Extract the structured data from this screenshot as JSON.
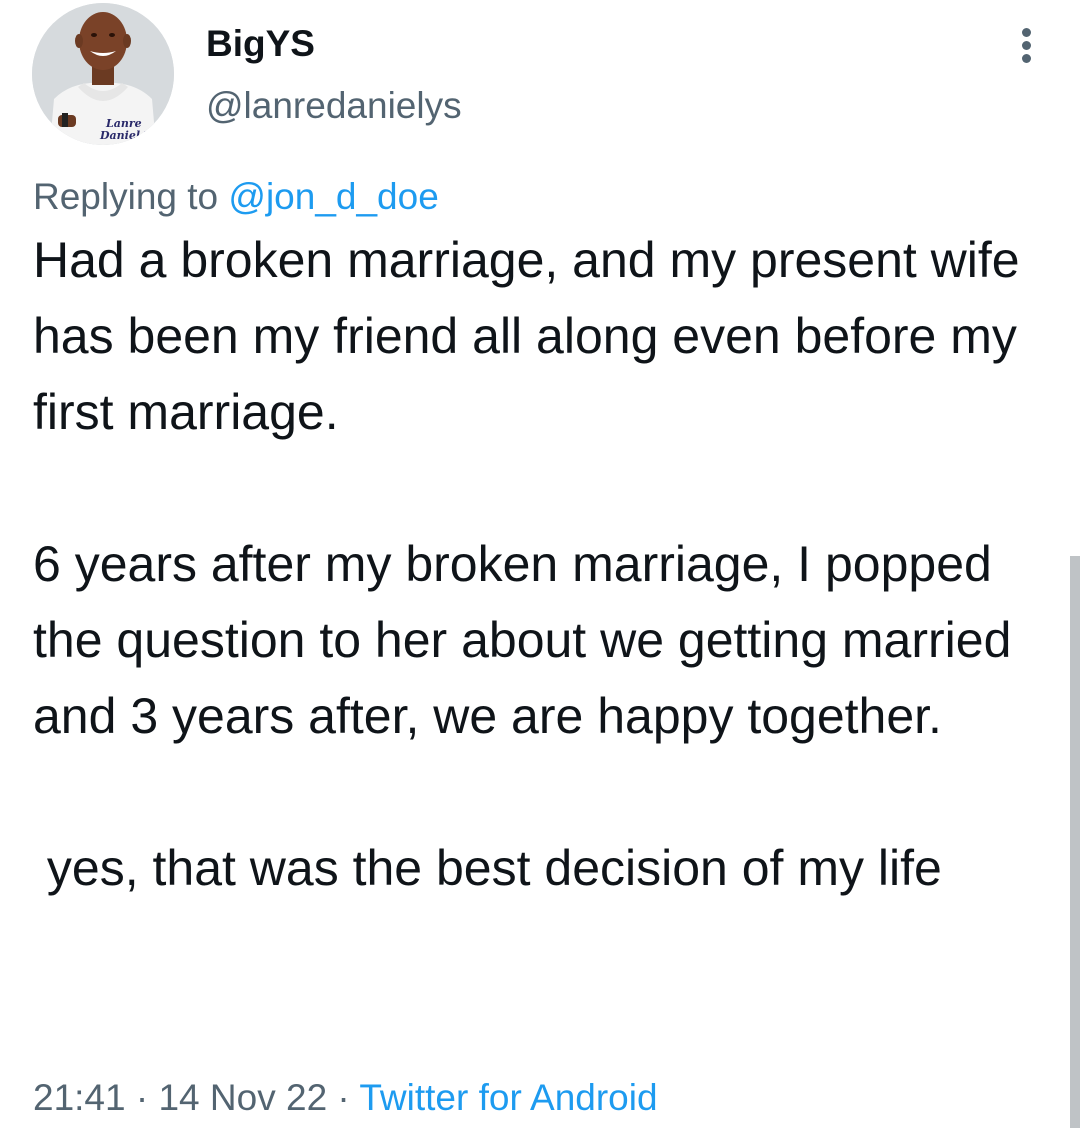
{
  "tweet": {
    "author": {
      "display_name": "BigYS",
      "handle": "@lanredanielys",
      "avatar_text": [
        "Lanre",
        "Daniel YS"
      ]
    },
    "reply": {
      "prefix": "Replying to ",
      "mention": "@jon_d_doe"
    },
    "paragraphs": [
      "Had a broken marriage, and my present wife has been my friend all along even before my first marriage.",
      "6 years after my broken marriage, I popped the question to her about we getting married and 3 years after, we are happy together.",
      " yes, that was the best decision of my life"
    ],
    "time": "21:41",
    "separator": " · ",
    "date": "14 Nov 22",
    "source": "Twitter for Android"
  },
  "icons": {
    "more": "more-vertical-icon"
  },
  "colors": {
    "text": "#0f1419",
    "secondary": "#536471",
    "link": "#1d9bf0"
  }
}
